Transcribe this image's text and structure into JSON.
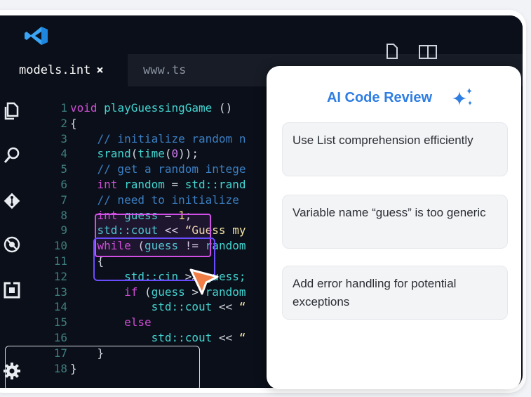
{
  "editor": {
    "tabs": [
      {
        "label": "models.int",
        "close": "×"
      },
      {
        "label": "www.ts"
      }
    ],
    "code_lines": [
      {
        "n": "1",
        "parts": [
          [
            "k",
            "void "
          ],
          [
            "f",
            "playGuessingGame"
          ],
          [
            "p",
            " ()"
          ]
        ]
      },
      {
        "n": "2",
        "parts": [
          [
            "p",
            "{"
          ]
        ]
      },
      {
        "n": "3",
        "parts": [
          [
            "c",
            "    // initialize random n"
          ]
        ]
      },
      {
        "n": "4",
        "parts": [
          [
            "f",
            "    srand"
          ],
          [
            "p",
            "("
          ],
          [
            "f",
            "time"
          ],
          [
            "p",
            "("
          ],
          [
            "n",
            "0"
          ],
          [
            "p",
            "));"
          ]
        ]
      },
      {
        "n": "5",
        "parts": [
          [
            "c",
            "    // get a random intege"
          ]
        ]
      },
      {
        "n": "6",
        "parts": [
          [
            "k",
            "    int "
          ],
          [
            "f",
            "random "
          ],
          [
            "p",
            "= "
          ],
          [
            "f",
            "std::rand"
          ]
        ]
      },
      {
        "n": "7",
        "parts": [
          [
            "c",
            "    // need to initialize"
          ]
        ]
      },
      {
        "n": "8",
        "parts": [
          [
            "k",
            "    int "
          ],
          [
            "f",
            "guess "
          ],
          [
            "p",
            "= "
          ],
          [
            "y",
            "1"
          ],
          [
            "p",
            ";"
          ]
        ]
      },
      {
        "n": "9",
        "parts": [
          [
            "f",
            "    std::cout "
          ],
          [
            "p",
            "<< "
          ],
          [
            "s",
            "“Guess my"
          ]
        ]
      },
      {
        "n": "10",
        "parts": [
          [
            "k",
            "    while "
          ],
          [
            "p",
            "("
          ],
          [
            "f",
            "guess "
          ],
          [
            "p",
            "!= "
          ],
          [
            "f",
            "random"
          ]
        ]
      },
      {
        "n": "11",
        "parts": [
          [
            "p",
            "    {"
          ]
        ]
      },
      {
        "n": "12",
        "parts": [
          [
            "f",
            "        std::cin "
          ],
          [
            "p",
            ">> "
          ],
          [
            "f",
            "guess;"
          ]
        ]
      },
      {
        "n": "13",
        "parts": [
          [
            "k",
            "        if "
          ],
          [
            "p",
            "("
          ],
          [
            "f",
            "guess "
          ],
          [
            "p",
            "> "
          ],
          [
            "f",
            "random"
          ]
        ]
      },
      {
        "n": "14",
        "parts": [
          [
            "f",
            "            std::cout "
          ],
          [
            "p",
            "<< "
          ],
          [
            "s",
            "“"
          ]
        ]
      },
      {
        "n": "15",
        "parts": [
          [
            "k",
            "        else"
          ]
        ]
      },
      {
        "n": "16",
        "parts": [
          [
            "f",
            "            std::cout "
          ],
          [
            "p",
            "<< "
          ],
          [
            "s",
            "“"
          ]
        ]
      },
      {
        "n": "17",
        "parts": [
          [
            "p",
            "    }"
          ]
        ]
      },
      {
        "n": "18",
        "parts": [
          [
            "p",
            "}"
          ]
        ]
      }
    ]
  },
  "review": {
    "title": "AI Code Review",
    "suggestions": [
      "Use List comprehension efficiently",
      "Variable name “guess” is too generic",
      "Add error handling for potential exceptions"
    ]
  },
  "icons": {
    "logo": "vscode-logo-icon",
    "activity": [
      "files-icon",
      "search-icon",
      "git-icon",
      "debug-icon",
      "extensions-icon",
      "settings-gear-icon"
    ],
    "sparkle": "sparkle-icon"
  },
  "colors": {
    "accent": "#2f7ee2",
    "highlight_pink": "#d24fe7",
    "highlight_purple": "#6a4cff",
    "editor_bg": "#0b0f19"
  }
}
